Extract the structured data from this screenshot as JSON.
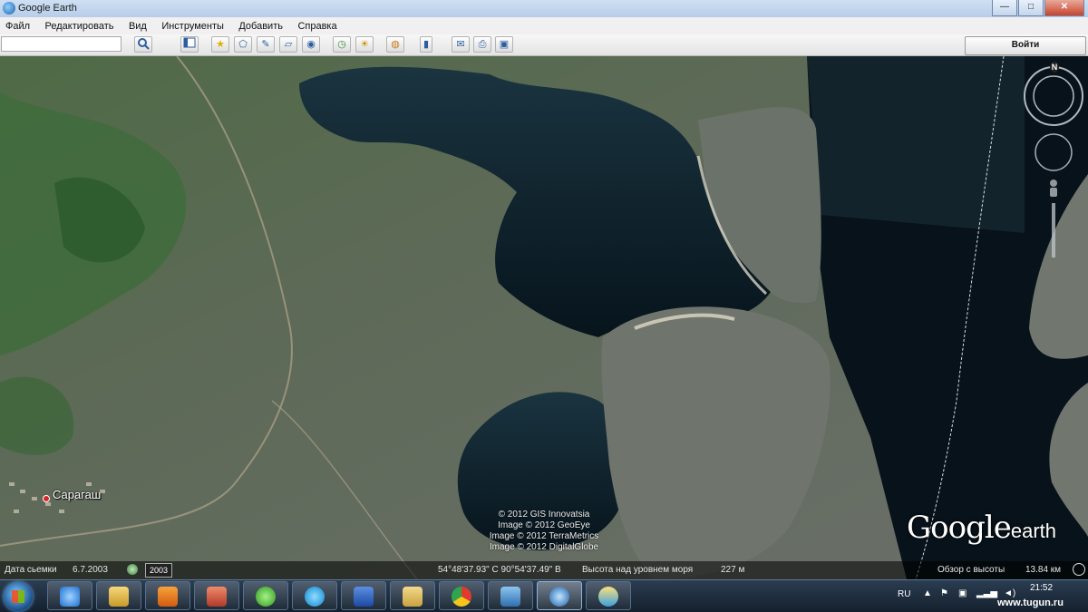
{
  "window": {
    "title": "Google Earth",
    "buttons": {
      "minimize": "—",
      "maximize": "□",
      "close": "✕"
    }
  },
  "menu": [
    "Файл",
    "Редактировать",
    "Вид",
    "Инструменты",
    "Добавить",
    "Справка"
  ],
  "toolbar": {
    "search_value": "",
    "signin_label": "Войти",
    "buttons": [
      "search-icon",
      "sidebar-icon",
      "placemark-icon",
      "polygon-icon",
      "path-icon",
      "image-overlay-icon",
      "record-tour-icon",
      "historical-imagery-icon",
      "sunlight-icon",
      "planets-icon",
      "ruler-icon",
      "email-icon",
      "print-icon",
      "save-image-icon"
    ]
  },
  "map": {
    "place_label": "Сарагаш",
    "copyright": [
      "© 2012 GIS Innovatsia",
      "Image © 2012 GeoEye",
      "Image © 2012 TerraMetrics",
      "Image © 2012 DigitalGlobe"
    ],
    "logo_google": "Google",
    "logo_earth": "earth",
    "compass_north": "N"
  },
  "status": {
    "imagery_date_label": "Дата сьемки",
    "imagery_date": "6.7.2003",
    "year_badge": "2003",
    "coordinates": "54°48'37.93\" С 90°54'37.49\" В",
    "elevation_label": "Высота над уровнем моря",
    "elevation_value": "227 м",
    "eye_alt_label": "Обзор с высоты",
    "eye_alt_value": "13.84 км"
  },
  "taskbar": {
    "apps": [
      "internet-explorer-icon",
      "file-explorer-icon",
      "media-player-icon",
      "archive-icon",
      "mail-agent-icon",
      "skype-icon",
      "word-icon",
      "folder-icon",
      "chrome-icon",
      "picture-viewer-icon",
      "google-earth-icon",
      "paint-icon"
    ],
    "language": "RU",
    "time": "21:52"
  },
  "watermark": "www.tugun.ru"
}
